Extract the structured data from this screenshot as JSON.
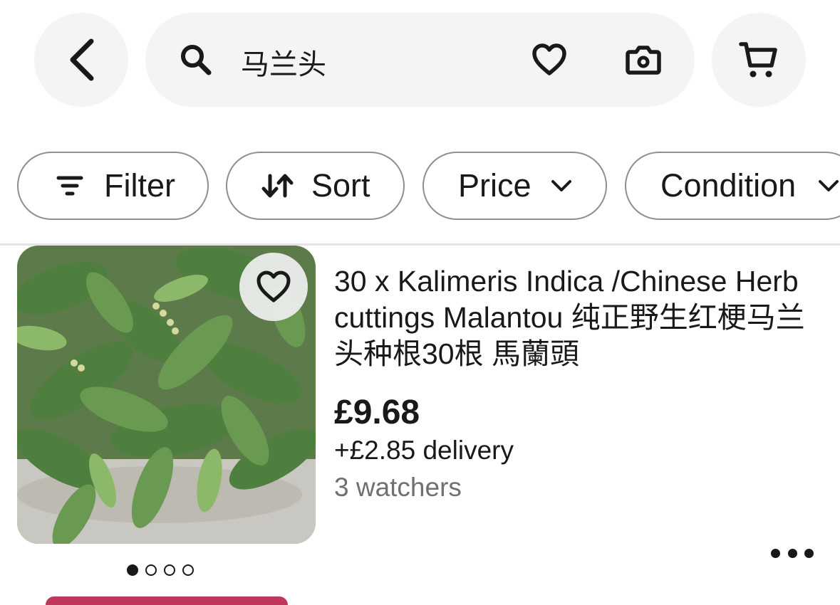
{
  "header": {
    "back_icon": "chevron-left-icon",
    "search": {
      "query": "马兰头",
      "search_icon": "search-icon",
      "watchlist_icon": "heart-icon",
      "camera_icon": "camera-icon"
    },
    "cart_icon": "cart-icon"
  },
  "filters": [
    {
      "label": "Filter",
      "icon": "filter-icon"
    },
    {
      "label": "Sort",
      "icon": "sort-arrows-icon"
    },
    {
      "label": "Price",
      "icon": "chevron-down-icon"
    },
    {
      "label": "Condition",
      "icon": "chevron-down-icon"
    }
  ],
  "listing": {
    "title": "30 x Kalimeris Indica /Chinese Herb cuttings Malantou 纯正野生红梗马兰头种根30根 馬蘭頭",
    "price": "£9.68",
    "delivery": "+£2.85 delivery",
    "watchers": "3 watchers",
    "image_count": 4,
    "active_image": 1
  },
  "colors": {
    "text": "#191919",
    "muted": "#707070",
    "surface": "#f4f4f4",
    "chip_border": "#8f8f8f"
  }
}
